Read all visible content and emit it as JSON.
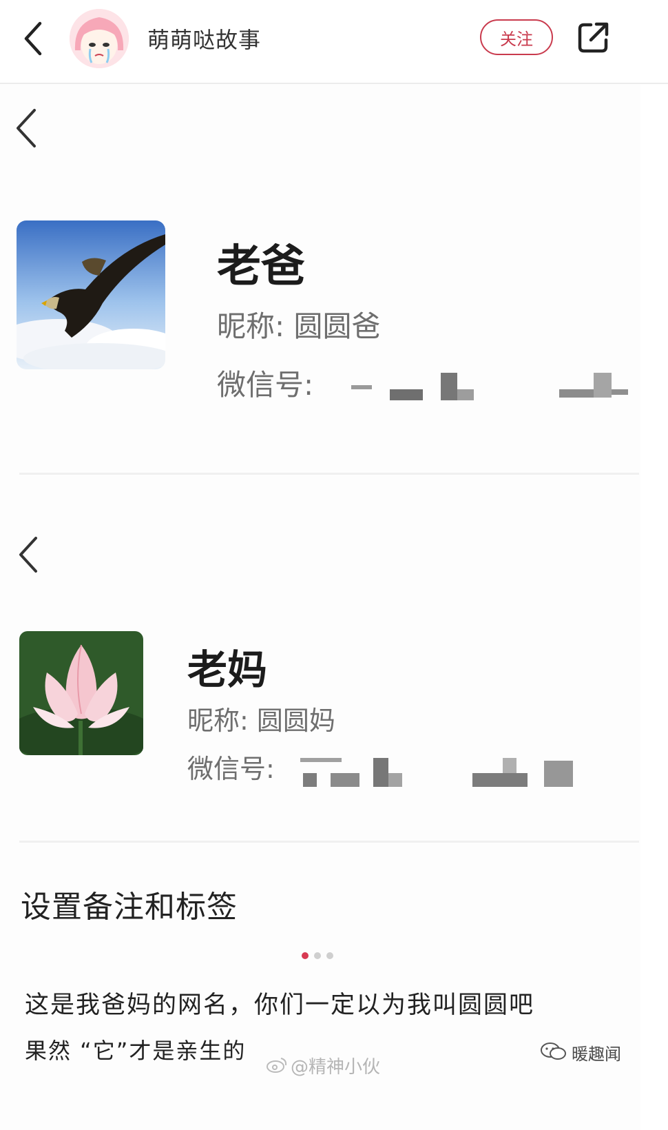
{
  "header": {
    "author": "萌萌哒故事",
    "follow_label": "关注"
  },
  "contacts": [
    {
      "name": "老爸",
      "nickname": "昵称:  圆圆爸",
      "wechat_label": "微信号:"
    },
    {
      "name": "老妈",
      "nickname": "昵称:  圆圆妈",
      "wechat_label": "微信号:"
    }
  ],
  "settings_label": "设置备注和标签",
  "pagination": {
    "total": 3,
    "active": 1
  },
  "caption": {
    "line1": "这是我爸妈的网名，你们一定以为我叫圆圆吧",
    "line2": "果然 “它”才是亲生的"
  },
  "watermarks": {
    "weibo": "@精神小伙",
    "wechat": "暖趣闻"
  },
  "colors": {
    "accent": "#c93a4d",
    "dot_active": "#d83a52"
  },
  "icons": [
    "back-icon",
    "share-icon",
    "eagle-avatar",
    "lotus-avatar",
    "weibo-icon",
    "wechat-icon"
  ]
}
